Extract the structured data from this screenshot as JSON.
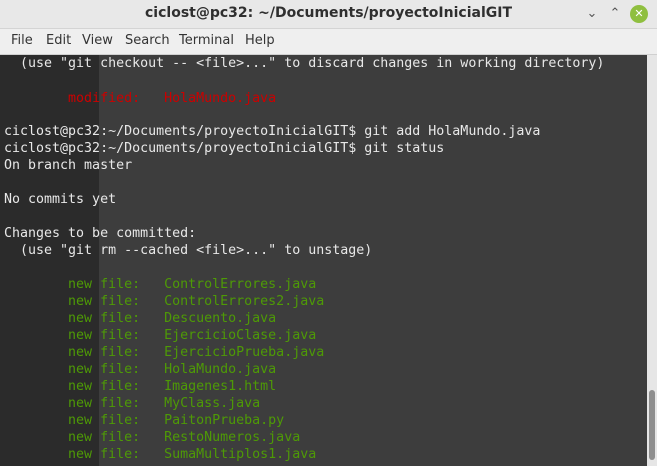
{
  "window": {
    "title": "ciclost@pc32: ~/Documents/proyectoInicialGIT"
  },
  "window_controls": {
    "minimize": "⌄",
    "maximize": "⌃",
    "close": "✕"
  },
  "menu": [
    "File",
    "Edit",
    "View",
    "Search",
    "Terminal",
    "Help"
  ],
  "terminal": {
    "line1": "  (use \"git checkout -- <file>...\" to discard changes in working directory)",
    "modified_prefix": "        ",
    "modified_text": "modified:   HolaMundo.java",
    "prompt1": "ciclost@pc32:~/Documents/proyectoInicialGIT$ git add HolaMundo.java",
    "prompt2": "ciclost@pc32:~/Documents/proyectoInicialGIT$ git status",
    "branch": "On branch master",
    "no_commits": "No commits yet",
    "changes_header": "Changes to be committed:",
    "unstage_hint": "  (use \"git rm --cached <file>...\" to unstage)",
    "new_files": [
      "        new file:   ControlErrores.java",
      "        new file:   ControlErrores2.java",
      "        new file:   Descuento.java",
      "        new file:   EjercicioClase.java",
      "        new file:   EjercicioPrueba.java",
      "        new file:   HolaMundo.java",
      "        new file:   Imagenes1.html",
      "        new file:   MyClass.java",
      "        new file:   PaitonPrueba.py",
      "        new file:   RestoNumeros.java",
      "        new file:   SumaMultiplos1.java"
    ]
  },
  "colors": {
    "modified": "#cc0000",
    "new_file": "#4e9a06",
    "text": "#e8e8e8",
    "background": "#3d3d3d"
  }
}
